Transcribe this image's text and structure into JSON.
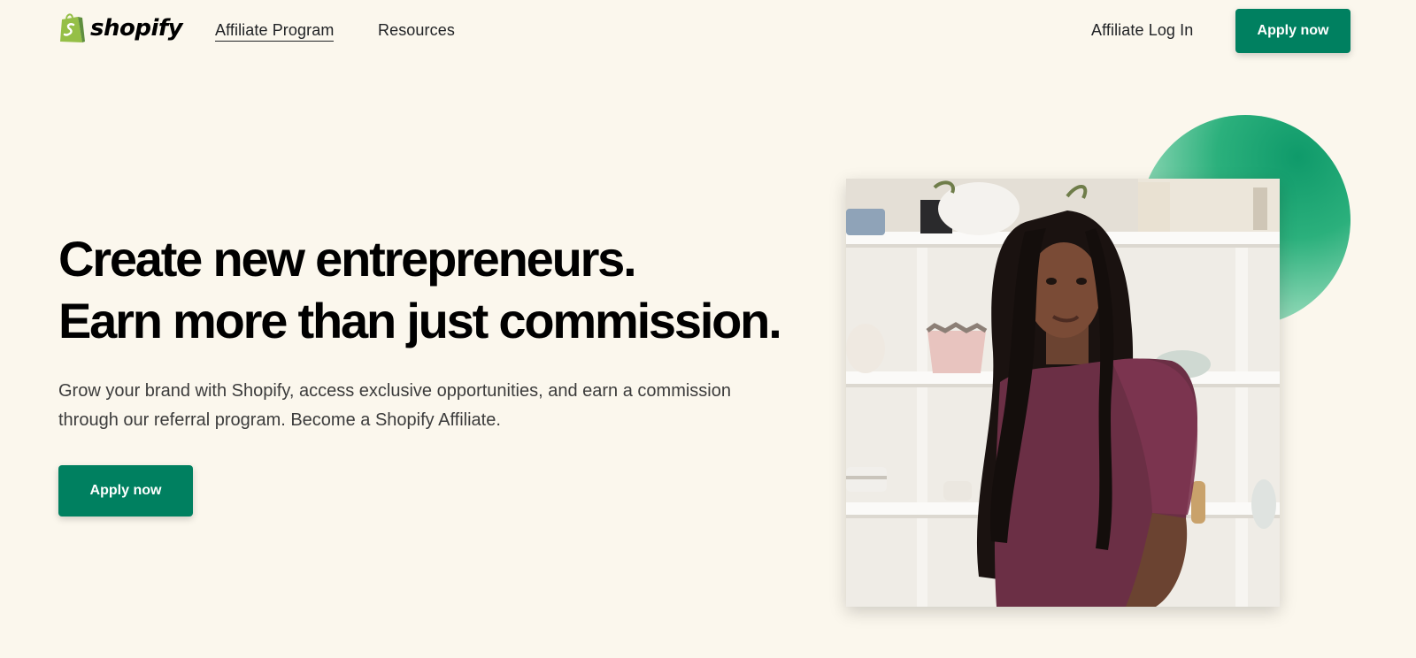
{
  "nav": {
    "brand": "shopify",
    "links": [
      {
        "label": "Affiliate Program",
        "active": true
      },
      {
        "label": "Resources",
        "active": false
      }
    ],
    "login": "Affiliate Log In",
    "apply": "Apply now"
  },
  "hero": {
    "title_line1": "Create new entrepreneurs.",
    "title_line2": "Earn more than just commission.",
    "subtitle": "Grow your brand with Shopify, access exclusive opportunities, and earn a commission through our referral program. Become a Shopify Affiliate.",
    "apply": "Apply now"
  },
  "colors": {
    "background": "#fbf7ed",
    "brand_green": "#008060",
    "logo_green": "#95bf47",
    "accent_circle": "#2bb07c"
  },
  "icons": [
    "shopify-bag-icon"
  ]
}
